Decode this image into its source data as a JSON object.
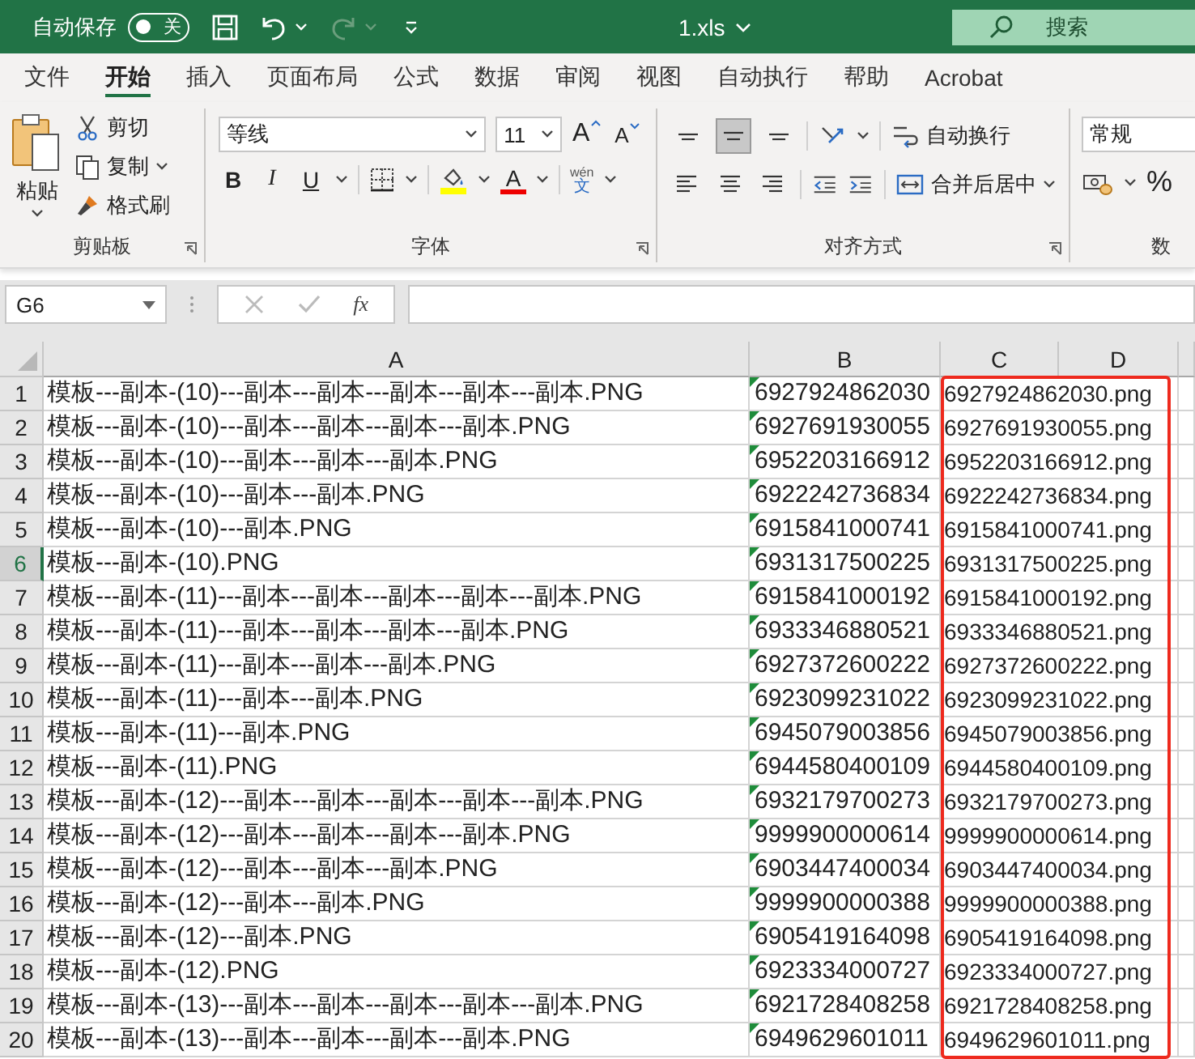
{
  "title_bar": {
    "autosave_label": "自动保存",
    "autosave_on": false,
    "autosave_state": "关",
    "file_name": "1.xls",
    "search_placeholder": "搜索"
  },
  "tabs": [
    {
      "label": "文件",
      "selected": false
    },
    {
      "label": "开始",
      "selected": true
    },
    {
      "label": "插入",
      "selected": false
    },
    {
      "label": "页面布局",
      "selected": false
    },
    {
      "label": "公式",
      "selected": false
    },
    {
      "label": "数据",
      "selected": false
    },
    {
      "label": "审阅",
      "selected": false
    },
    {
      "label": "视图",
      "selected": false
    },
    {
      "label": "自动执行",
      "selected": false
    },
    {
      "label": "帮助",
      "selected": false
    },
    {
      "label": "Acrobat",
      "selected": false
    }
  ],
  "ribbon": {
    "clipboard": {
      "paste": "粘贴",
      "cut": "剪切",
      "copy": "复制",
      "format_painter": "格式刷",
      "label": "剪贴板"
    },
    "font": {
      "name": "等线",
      "size": "11",
      "grow": "A",
      "shrink": "A",
      "bold": "B",
      "italic": "I",
      "underline": "U",
      "font_color": "A",
      "phonetic_top": "wén",
      "phonetic_bottom": "文",
      "label": "字体"
    },
    "alignment": {
      "vertical": [
        {
          "kind": "top",
          "selected": false
        },
        {
          "kind": "middle",
          "selected": true
        },
        {
          "kind": "bottom",
          "selected": false
        }
      ],
      "horizontal": [
        {
          "kind": "left",
          "selected": false
        },
        {
          "kind": "center",
          "selected": false
        },
        {
          "kind": "right",
          "selected": false
        }
      ],
      "wrap": "自动换行",
      "merge": "合并后居中",
      "label": "对齐方式"
    },
    "number": {
      "format": "常规",
      "percent": "%",
      "label": "数"
    }
  },
  "formula_bar": {
    "cell": "G6",
    "fx": "fx"
  },
  "sheet": {
    "columns": [
      "A",
      "B",
      "C",
      "D"
    ],
    "rows": [
      {
        "number": "1",
        "a": "模板---副本-(10)---副本---副本---副本---副本---副本.PNG",
        "b": "6927924862030",
        "c": "6927924862030.png",
        "selected": false,
        "number_as_text": true
      },
      {
        "number": "2",
        "a": "模板---副本-(10)---副本---副本---副本---副本.PNG",
        "b": "6927691930055",
        "c": "6927691930055.png",
        "selected": false,
        "number_as_text": true
      },
      {
        "number": "3",
        "a": "模板---副本-(10)---副本---副本---副本.PNG",
        "b": "6952203166912",
        "c": "6952203166912.png",
        "selected": false,
        "number_as_text": true
      },
      {
        "number": "4",
        "a": "模板---副本-(10)---副本---副本.PNG",
        "b": "6922242736834",
        "c": "6922242736834.png",
        "selected": false,
        "number_as_text": true
      },
      {
        "number": "5",
        "a": "模板---副本-(10)---副本.PNG",
        "b": "6915841000741",
        "c": "6915841000741.png",
        "selected": false,
        "number_as_text": true
      },
      {
        "number": "6",
        "a": "模板---副本-(10).PNG",
        "b": "6931317500225",
        "c": "6931317500225.png",
        "selected": true,
        "number_as_text": true
      },
      {
        "number": "7",
        "a": "模板---副本-(11)---副本---副本---副本---副本---副本.PNG",
        "b": "6915841000192",
        "c": "6915841000192.png",
        "selected": false,
        "number_as_text": true
      },
      {
        "number": "8",
        "a": "模板---副本-(11)---副本---副本---副本---副本.PNG",
        "b": "6933346880521",
        "c": "6933346880521.png",
        "selected": false,
        "number_as_text": true
      },
      {
        "number": "9",
        "a": "模板---副本-(11)---副本---副本---副本.PNG",
        "b": "6927372600222",
        "c": "6927372600222.png",
        "selected": false,
        "number_as_text": true
      },
      {
        "number": "10",
        "a": "模板---副本-(11)---副本---副本.PNG",
        "b": "6923099231022",
        "c": "6923099231022.png",
        "selected": false,
        "number_as_text": true
      },
      {
        "number": "11",
        "a": "模板---副本-(11)---副本.PNG",
        "b": "6945079003856",
        "c": "6945079003856.png",
        "selected": false,
        "number_as_text": true
      },
      {
        "number": "12",
        "a": "模板---副本-(11).PNG",
        "b": "6944580400109",
        "c": "6944580400109.png",
        "selected": false,
        "number_as_text": true
      },
      {
        "number": "13",
        "a": "模板---副本-(12)---副本---副本---副本---副本---副本.PNG",
        "b": "6932179700273",
        "c": "6932179700273.png",
        "selected": false,
        "number_as_text": true
      },
      {
        "number": "14",
        "a": "模板---副本-(12)---副本---副本---副本---副本.PNG",
        "b": "9999900000614",
        "c": "9999900000614.png",
        "selected": false,
        "number_as_text": true
      },
      {
        "number": "15",
        "a": "模板---副本-(12)---副本---副本---副本.PNG",
        "b": "6903447400034",
        "c": "6903447400034.png",
        "selected": false,
        "number_as_text": true
      },
      {
        "number": "16",
        "a": "模板---副本-(12)---副本---副本.PNG",
        "b": "9999900000388",
        "c": "9999900000388.png",
        "selected": false,
        "number_as_text": true
      },
      {
        "number": "17",
        "a": "模板---副本-(12)---副本.PNG",
        "b": "6905419164098",
        "c": "6905419164098.png",
        "selected": false,
        "number_as_text": true
      },
      {
        "number": "18",
        "a": "模板---副本-(12).PNG",
        "b": "6923334000727",
        "c": "6923334000727.png",
        "selected": false,
        "number_as_text": true
      },
      {
        "number": "19",
        "a": "模板---副本-(13)---副本---副本---副本---副本---副本.PNG",
        "b": "6921728408258",
        "c": "6921728408258.png",
        "selected": false,
        "number_as_text": true
      },
      {
        "number": "20",
        "a": "模板---副本-(13)---副本---副本---副本---副本.PNG",
        "b": "6949629601011",
        "c": "6949629601011.png",
        "selected": false,
        "number_as_text": true
      }
    ]
  }
}
